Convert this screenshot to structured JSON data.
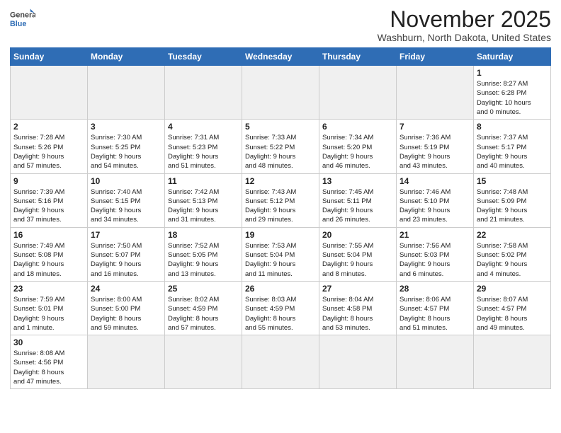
{
  "logo": {
    "line1": "General",
    "line2": "Blue"
  },
  "title": "November 2025",
  "subtitle": "Washburn, North Dakota, United States",
  "headers": [
    "Sunday",
    "Monday",
    "Tuesday",
    "Wednesday",
    "Thursday",
    "Friday",
    "Saturday"
  ],
  "weeks": [
    [
      {
        "day": "",
        "info": ""
      },
      {
        "day": "",
        "info": ""
      },
      {
        "day": "",
        "info": ""
      },
      {
        "day": "",
        "info": ""
      },
      {
        "day": "",
        "info": ""
      },
      {
        "day": "",
        "info": ""
      },
      {
        "day": "1",
        "info": "Sunrise: 8:27 AM\nSunset: 6:28 PM\nDaylight: 10 hours\nand 0 minutes."
      }
    ],
    [
      {
        "day": "2",
        "info": "Sunrise: 7:28 AM\nSunset: 5:26 PM\nDaylight: 9 hours\nand 57 minutes."
      },
      {
        "day": "3",
        "info": "Sunrise: 7:30 AM\nSunset: 5:25 PM\nDaylight: 9 hours\nand 54 minutes."
      },
      {
        "day": "4",
        "info": "Sunrise: 7:31 AM\nSunset: 5:23 PM\nDaylight: 9 hours\nand 51 minutes."
      },
      {
        "day": "5",
        "info": "Sunrise: 7:33 AM\nSunset: 5:22 PM\nDaylight: 9 hours\nand 48 minutes."
      },
      {
        "day": "6",
        "info": "Sunrise: 7:34 AM\nSunset: 5:20 PM\nDaylight: 9 hours\nand 46 minutes."
      },
      {
        "day": "7",
        "info": "Sunrise: 7:36 AM\nSunset: 5:19 PM\nDaylight: 9 hours\nand 43 minutes."
      },
      {
        "day": "8",
        "info": "Sunrise: 7:37 AM\nSunset: 5:17 PM\nDaylight: 9 hours\nand 40 minutes."
      }
    ],
    [
      {
        "day": "9",
        "info": "Sunrise: 7:39 AM\nSunset: 5:16 PM\nDaylight: 9 hours\nand 37 minutes."
      },
      {
        "day": "10",
        "info": "Sunrise: 7:40 AM\nSunset: 5:15 PM\nDaylight: 9 hours\nand 34 minutes."
      },
      {
        "day": "11",
        "info": "Sunrise: 7:42 AM\nSunset: 5:13 PM\nDaylight: 9 hours\nand 31 minutes."
      },
      {
        "day": "12",
        "info": "Sunrise: 7:43 AM\nSunset: 5:12 PM\nDaylight: 9 hours\nand 29 minutes."
      },
      {
        "day": "13",
        "info": "Sunrise: 7:45 AM\nSunset: 5:11 PM\nDaylight: 9 hours\nand 26 minutes."
      },
      {
        "day": "14",
        "info": "Sunrise: 7:46 AM\nSunset: 5:10 PM\nDaylight: 9 hours\nand 23 minutes."
      },
      {
        "day": "15",
        "info": "Sunrise: 7:48 AM\nSunset: 5:09 PM\nDaylight: 9 hours\nand 21 minutes."
      }
    ],
    [
      {
        "day": "16",
        "info": "Sunrise: 7:49 AM\nSunset: 5:08 PM\nDaylight: 9 hours\nand 18 minutes."
      },
      {
        "day": "17",
        "info": "Sunrise: 7:50 AM\nSunset: 5:07 PM\nDaylight: 9 hours\nand 16 minutes."
      },
      {
        "day": "18",
        "info": "Sunrise: 7:52 AM\nSunset: 5:05 PM\nDaylight: 9 hours\nand 13 minutes."
      },
      {
        "day": "19",
        "info": "Sunrise: 7:53 AM\nSunset: 5:04 PM\nDaylight: 9 hours\nand 11 minutes."
      },
      {
        "day": "20",
        "info": "Sunrise: 7:55 AM\nSunset: 5:04 PM\nDaylight: 9 hours\nand 8 minutes."
      },
      {
        "day": "21",
        "info": "Sunrise: 7:56 AM\nSunset: 5:03 PM\nDaylight: 9 hours\nand 6 minutes."
      },
      {
        "day": "22",
        "info": "Sunrise: 7:58 AM\nSunset: 5:02 PM\nDaylight: 9 hours\nand 4 minutes."
      }
    ],
    [
      {
        "day": "23",
        "info": "Sunrise: 7:59 AM\nSunset: 5:01 PM\nDaylight: 9 hours\nand 1 minute."
      },
      {
        "day": "24",
        "info": "Sunrise: 8:00 AM\nSunset: 5:00 PM\nDaylight: 8 hours\nand 59 minutes."
      },
      {
        "day": "25",
        "info": "Sunrise: 8:02 AM\nSunset: 4:59 PM\nDaylight: 8 hours\nand 57 minutes."
      },
      {
        "day": "26",
        "info": "Sunrise: 8:03 AM\nSunset: 4:59 PM\nDaylight: 8 hours\nand 55 minutes."
      },
      {
        "day": "27",
        "info": "Sunrise: 8:04 AM\nSunset: 4:58 PM\nDaylight: 8 hours\nand 53 minutes."
      },
      {
        "day": "28",
        "info": "Sunrise: 8:06 AM\nSunset: 4:57 PM\nDaylight: 8 hours\nand 51 minutes."
      },
      {
        "day": "29",
        "info": "Sunrise: 8:07 AM\nSunset: 4:57 PM\nDaylight: 8 hours\nand 49 minutes."
      }
    ],
    [
      {
        "day": "30",
        "info": "Sunrise: 8:08 AM\nSunset: 4:56 PM\nDaylight: 8 hours\nand 47 minutes."
      },
      {
        "day": "",
        "info": ""
      },
      {
        "day": "",
        "info": ""
      },
      {
        "day": "",
        "info": ""
      },
      {
        "day": "",
        "info": ""
      },
      {
        "day": "",
        "info": ""
      },
      {
        "day": "",
        "info": ""
      }
    ]
  ]
}
